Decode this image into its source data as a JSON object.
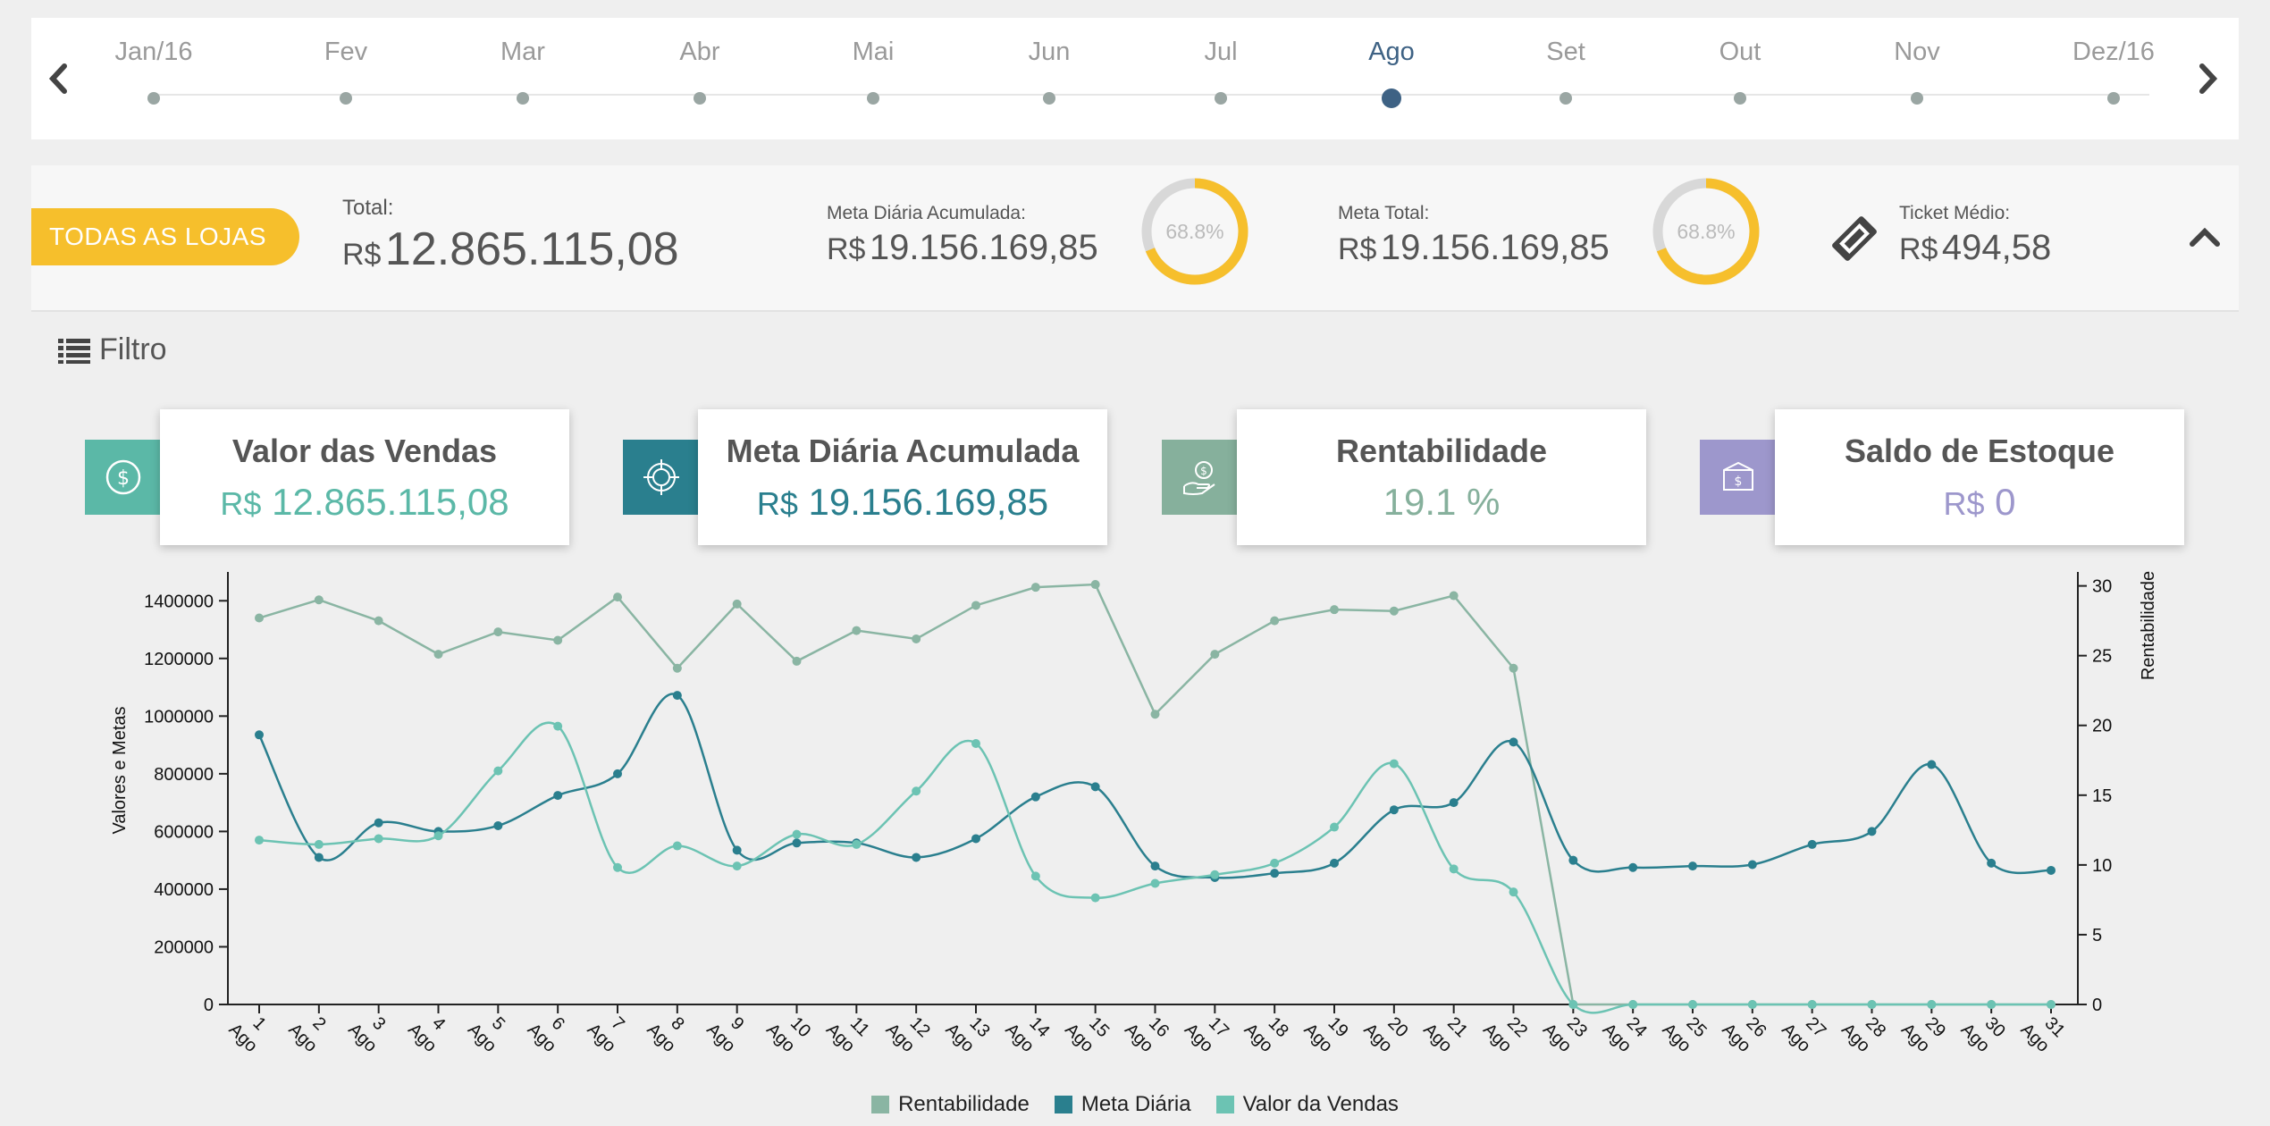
{
  "timeline": {
    "months": [
      "Jan/16",
      "Fev",
      "Mar",
      "Abr",
      "Mai",
      "Jun",
      "Jul",
      "Ago",
      "Set",
      "Out",
      "Nov",
      "Dez/16"
    ],
    "active_index": 7,
    "prev_icon": "chevron-left-icon",
    "next_icon": "chevron-right-icon"
  },
  "summary": {
    "stores_label": "TODAS AS LOJAS",
    "total_label": "Total:",
    "total_currency": "R$",
    "total_value": "12.865.115,08",
    "meta_diaria_label": "Meta Diária Acumulada:",
    "meta_diaria_currency": "R$",
    "meta_diaria_value": "19.156.169,85",
    "meta_diaria_pct": "68.8%",
    "meta_diaria_fraction": 0.688,
    "meta_total_label": "Meta Total:",
    "meta_total_currency": "R$",
    "meta_total_value": "19.156.169,85",
    "meta_total_pct": "68.8%",
    "meta_total_fraction": 0.688,
    "ticket_label": "Ticket Médio:",
    "ticket_currency": "R$",
    "ticket_value": "494,58",
    "ticket_icon": "ticket-icon",
    "collapse_icon": "chevron-up-icon"
  },
  "filter": {
    "label": "Filtro",
    "icon": "list-icon"
  },
  "kpis": [
    {
      "title": "Valor das Vendas",
      "currency": "R$",
      "value": "12.865.115,08",
      "color": "#5bb8a7",
      "icon": "dollar-circle-icon"
    },
    {
      "title": "Meta Diária Acumulada",
      "currency": "R$",
      "value": "19.156.169,85",
      "color": "#2a7f8e",
      "icon": "target-icon"
    },
    {
      "title": "Rentabilidade",
      "currency": "",
      "value": "19.1 %",
      "color": "#86b09c",
      "icon": "hand-coin-icon"
    },
    {
      "title": "Saldo de Estoque",
      "currency": "R$",
      "value": "0",
      "color": "#9d97cc",
      "icon": "box-icon"
    }
  ],
  "colors": {
    "accent": "#f6bf2c",
    "rentabilidade": "#8ab5a3",
    "meta_diaria": "#2a7f8e",
    "valor_vendas": "#6cc3b3"
  },
  "chart_data": {
    "type": "line",
    "ylabel": "Valores e Metas",
    "y2label": "Rentabilidade",
    "ylim": [
      0,
      1500000
    ],
    "y2lim": [
      0,
      31
    ],
    "yticks": [
      "0",
      "200000",
      "400000",
      "600000",
      "800000",
      "1000000",
      "1200000",
      "1400000"
    ],
    "yticks_values": [
      0,
      200000,
      400000,
      600000,
      800000,
      1000000,
      1200000,
      1400000
    ],
    "y2ticks": [
      "0",
      "5",
      "10",
      "15",
      "20",
      "25",
      "30"
    ],
    "y2ticks_values": [
      0,
      5,
      10,
      15,
      20,
      25,
      30
    ],
    "categories": [
      "1 Ago",
      "2 Ago",
      "3 Ago",
      "4 Ago",
      "5 Ago",
      "6 Ago",
      "7 Ago",
      "8 Ago",
      "9 Ago",
      "10 Ago",
      "11 Ago",
      "12 Ago",
      "13 Ago",
      "14 Ago",
      "15 Ago",
      "16 Ago",
      "17 Ago",
      "18 Ago",
      "19 Ago",
      "20 Ago",
      "21 Ago",
      "22 Ago",
      "23 Ago",
      "24 Ago",
      "25 Ago",
      "26 Ago",
      "27 Ago",
      "28 Ago",
      "29 Ago",
      "30 Ago",
      "31 Ago"
    ],
    "x_day": [
      "1",
      "2",
      "3",
      "4",
      "5",
      "6",
      "7",
      "8",
      "9",
      "10",
      "11",
      "12",
      "13",
      "14",
      "15",
      "16",
      "17",
      "18",
      "19",
      "20",
      "21",
      "22",
      "23",
      "24",
      "25",
      "26",
      "27",
      "28",
      "29",
      "30",
      "31"
    ],
    "x_month": "Ago",
    "series": [
      {
        "name": "Rentabilidade",
        "axis": "right",
        "color": "#8ab5a3",
        "values": [
          27.7,
          29.0,
          27.5,
          25.1,
          26.7,
          26.1,
          29.2,
          24.1,
          28.7,
          24.6,
          26.8,
          26.2,
          28.6,
          29.9,
          30.1,
          20.8,
          25.1,
          27.5,
          28.3,
          28.2,
          29.3,
          24.1,
          0,
          0,
          0,
          0,
          0,
          0,
          0,
          0,
          0
        ]
      },
      {
        "name": "Meta Diária",
        "axis": "left",
        "color": "#2a7f8e",
        "values": [
          935000,
          510000,
          630000,
          600000,
          620000,
          725000,
          800000,
          1072000,
          535000,
          560000,
          560000,
          510000,
          575000,
          720000,
          755000,
          480000,
          440000,
          455000,
          490000,
          675000,
          700000,
          910000,
          500000,
          475000,
          480000,
          485000,
          555000,
          600000,
          832000,
          490000,
          465000
        ]
      },
      {
        "name": "Valor da Vendas",
        "axis": "left",
        "color": "#6cc3b3",
        "values": [
          570000,
          555000,
          575000,
          585000,
          810000,
          965000,
          475000,
          550000,
          480000,
          590000,
          555000,
          740000,
          905000,
          445000,
          370000,
          420000,
          450000,
          490000,
          615000,
          835000,
          470000,
          390000,
          0,
          0,
          0,
          0,
          0,
          0,
          0,
          0,
          0
        ]
      }
    ]
  }
}
